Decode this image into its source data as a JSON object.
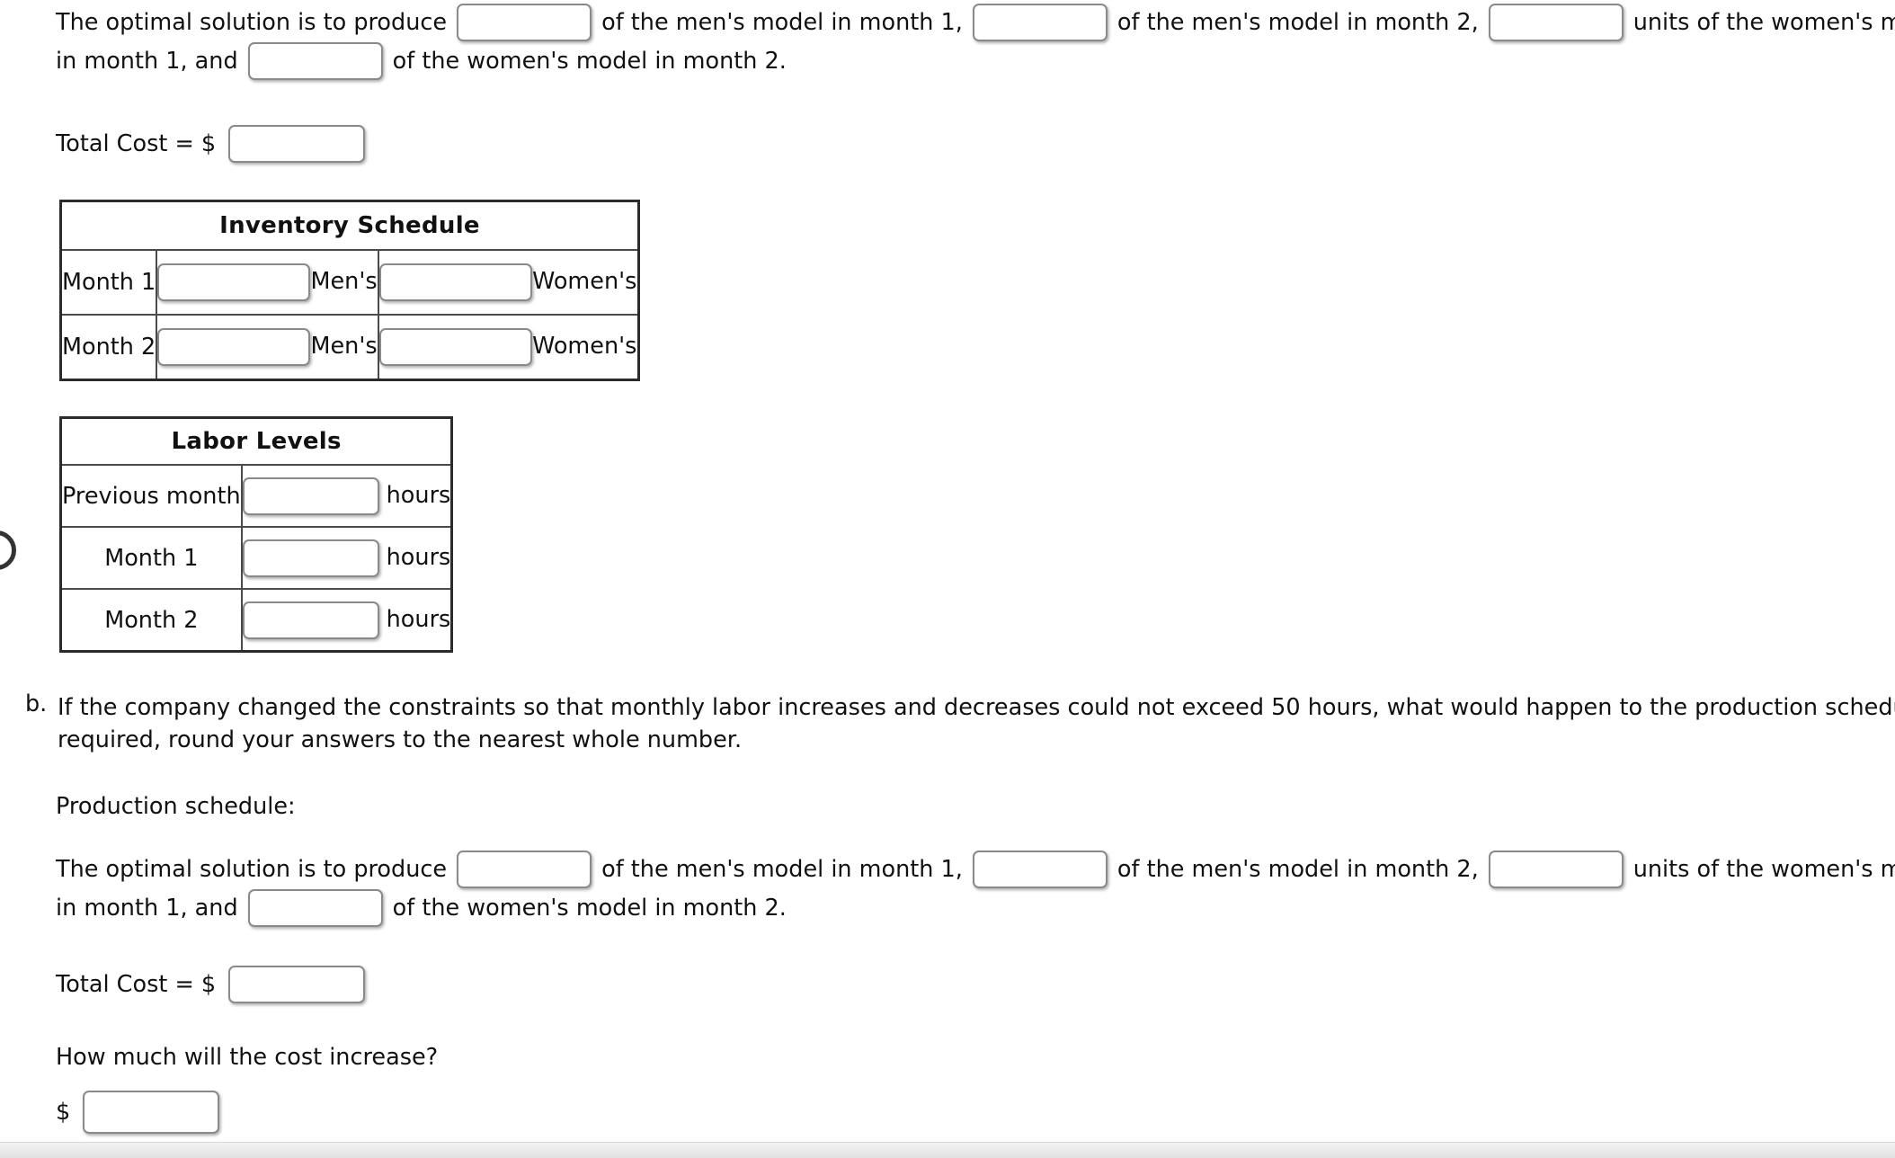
{
  "section_a": {
    "solution_sentence": {
      "lead": "The optimal solution is to produce",
      "seg2": "of the men's model in month 1,",
      "seg3": "of the men's model in month 2,",
      "seg4": "units of the women's model",
      "seg5": "in month 1, and",
      "seg6": "of the women's model in month 2.",
      "inputs": {
        "mens_month1": "",
        "mens_month2": "",
        "womens_month1": "",
        "womens_month2": ""
      }
    },
    "total_cost": {
      "label": "Total Cost = $",
      "value": ""
    },
    "inventory_schedule": {
      "title": "Inventory Schedule",
      "rows": [
        {
          "label": "Month 1",
          "mens_unit": "Men's",
          "mens_value": "",
          "womens_unit": "Women's",
          "womens_value": ""
        },
        {
          "label": "Month 2",
          "mens_unit": "Men's",
          "mens_value": "",
          "womens_unit": "Women's",
          "womens_value": ""
        }
      ]
    },
    "labor_levels": {
      "title": "Labor Levels",
      "rows": [
        {
          "label": "Previous month",
          "value": "",
          "unit": "hours"
        },
        {
          "label": "Month 1",
          "value": "",
          "unit": "hours"
        },
        {
          "label": "Month 2",
          "value": "",
          "unit": "hours"
        }
      ]
    }
  },
  "section_b": {
    "marker": "b.",
    "question_line1": "If the company changed the constraints so that monthly labor increases and decreases could not exceed 50 hours, what would happen to the production schedule? If",
    "question_line2": "required, round your answers to the nearest whole number.",
    "production_schedule_label": "Production schedule:",
    "solution_sentence": {
      "lead": "The optimal solution is to produce",
      "seg2": "of the men's model in month 1,",
      "seg3": "of the men's model in month 2,",
      "seg4": "units of the women's model",
      "seg5": "in month 1, and",
      "seg6": "of the women's model in month 2.",
      "inputs": {
        "mens_month1": "",
        "mens_month2": "",
        "womens_month1": "",
        "womens_month2": ""
      }
    },
    "total_cost": {
      "label": "Total Cost = $",
      "value": ""
    },
    "cost_increase": {
      "question": "How much will the cost increase?",
      "currency": "$",
      "value": ""
    }
  },
  "colors": {
    "text": "#111111",
    "input_border": "#8a8a8a",
    "table_border": "#2b2b2b",
    "scrollbar_track": "#ececec"
  }
}
